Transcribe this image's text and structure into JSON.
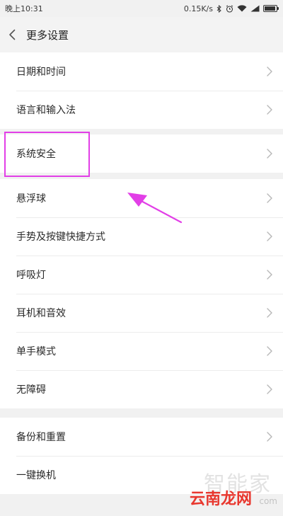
{
  "status_bar": {
    "time": "晚上10:31",
    "network_speed": "0.15K/s",
    "icons": [
      "bluetooth-icon",
      "alarm-icon",
      "wifi-icon",
      "signal-icon",
      "battery-icon"
    ]
  },
  "header": {
    "title": "更多设置",
    "back_icon": "chevron-left-icon"
  },
  "groups": [
    {
      "items": [
        {
          "label": "日期和时间"
        },
        {
          "label": "语言和输入法"
        }
      ]
    },
    {
      "items": [
        {
          "label": "系统安全"
        }
      ]
    },
    {
      "items": [
        {
          "label": "悬浮球"
        },
        {
          "label": "手势及按键快捷方式"
        },
        {
          "label": "呼吸灯"
        },
        {
          "label": "耳机和音效"
        },
        {
          "label": "单手模式"
        },
        {
          "label": "无障碍"
        }
      ]
    },
    {
      "items": [
        {
          "label": "备份和重置"
        },
        {
          "label": "一键换机"
        }
      ]
    }
  ],
  "annotation": {
    "color": "#e23fe7",
    "highlighted_item": "系统安全"
  },
  "watermark": {
    "top": "智能家",
    "bottom": "云南龙网",
    "small": "com"
  },
  "colors": {
    "background": "#f1f1f1",
    "card": "#ffffff",
    "accent": "#e23fe7",
    "watermark_red": "#e8382f"
  }
}
